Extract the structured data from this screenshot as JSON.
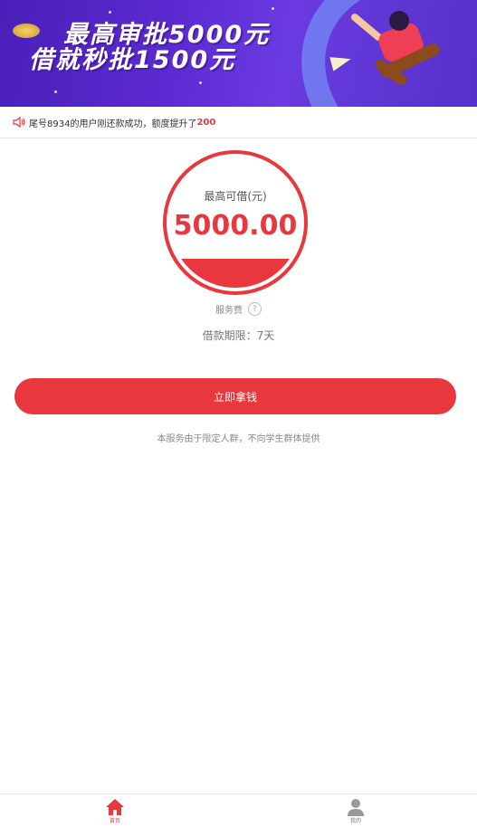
{
  "banner": {
    "line1": "最高审批5000元",
    "line2": "借就秒批1500元"
  },
  "notice": {
    "prefix": "尾号8934的用户刚还款成功，额度提升了",
    "highlight": "200",
    "icon": "speaker-icon",
    "color": "#e8383d"
  },
  "loan": {
    "caption": "最高可借(元)",
    "amount": "5000.00",
    "fee_label": "服务费",
    "fee_help": "?",
    "period": "借款期限：7天"
  },
  "cta": {
    "label": "立即拿钱"
  },
  "disclaimer": "本服务由于限定人群，不向学生群体提供",
  "tabbar": {
    "home_label": "首页",
    "mine_label": "我的",
    "home_icon": "home-icon",
    "mine_icon": "user-icon"
  },
  "colors": {
    "accent": "#e8383d",
    "banner": "#5a2ad0"
  }
}
